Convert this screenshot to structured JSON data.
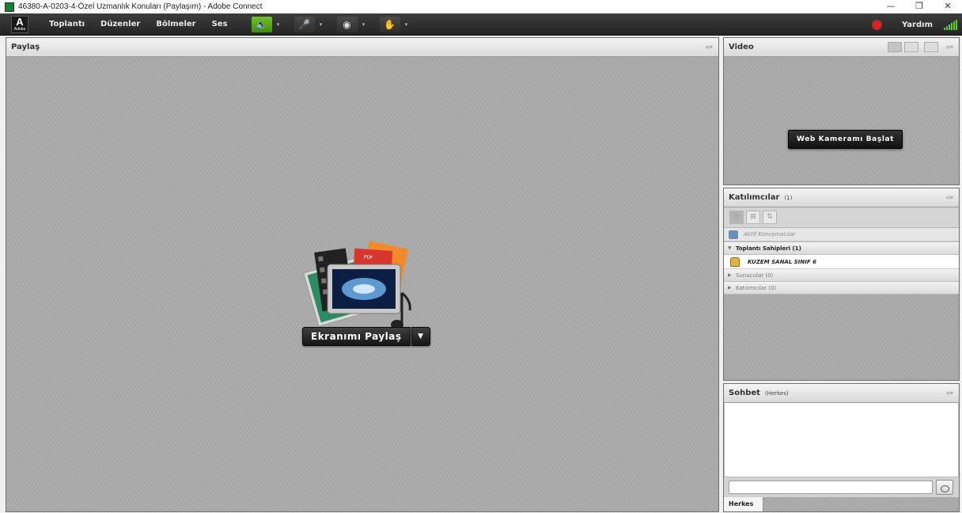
{
  "window": {
    "title": "46380-A-0203-4-Özel Uzmanlık Konuları (Paylaşım) - Adobe Connect",
    "minimize": "—",
    "restore": "❐",
    "close": "✕"
  },
  "menubar": {
    "logo_text": "Adobe",
    "items": [
      "Toplantı",
      "Düzenler",
      "Bölmeler",
      "Ses"
    ],
    "toolbar": [
      {
        "name": "speaker-icon",
        "glyph": "🔈",
        "active": true
      },
      {
        "name": "microphone-icon",
        "glyph": "🎤",
        "active": false
      },
      {
        "name": "webcam-icon",
        "glyph": "◉",
        "active": false
      },
      {
        "name": "raise-hand-icon",
        "glyph": "✋",
        "active": false
      }
    ],
    "dropdown_glyph": "▾",
    "help": "Yardım",
    "record_color": "#e02020",
    "signal_color": "#55d12a"
  },
  "share_pod": {
    "title": "Paylaş",
    "button_label": "Ekranımı Paylaş",
    "dropdown_glyph": "▼",
    "art_labels": [
      "PPT",
      "PDF"
    ]
  },
  "video_pod": {
    "title": "Video",
    "start_button": "Web Kameramı Başlat"
  },
  "attendees_pod": {
    "title": "Katılımcılar",
    "count": "(1)",
    "active_speakers": "Aktif Konuşmacılar",
    "hosts": "Toplantı Sahipleri (1)",
    "host_user": "KUZEM SANAL SINIF 6",
    "presenters": "Sunucular (0)",
    "participants": "Katılımcılar (0)"
  },
  "chat_pod": {
    "title": "Sohbet",
    "scope": "(Herkes)",
    "input_placeholder": "",
    "tab": "Herkes"
  }
}
